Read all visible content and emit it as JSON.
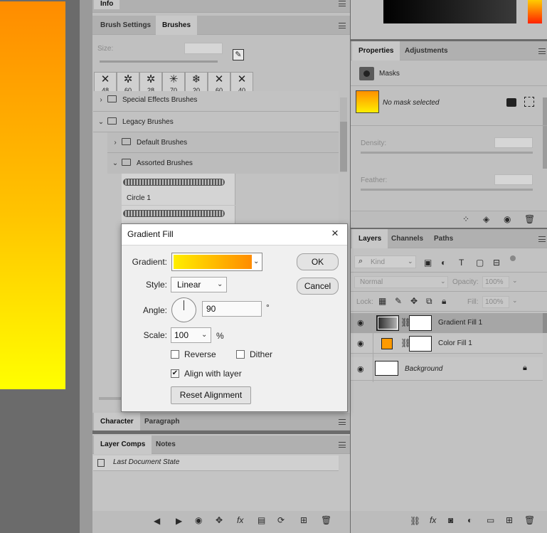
{
  "panels": {
    "info_tab": "Info",
    "brush_tabs": [
      "Brush Settings",
      "Brushes"
    ],
    "brushes": {
      "size_label": "Size:",
      "presets": [
        "48",
        "60",
        "28",
        "70",
        "20",
        "60",
        "40"
      ],
      "tree": {
        "special_effects": "Special Effects Brushes",
        "legacy": "Legacy Brushes",
        "default": "Default Brushes",
        "assorted": "Assorted Brushes",
        "circle": "Circle 1"
      }
    },
    "char_tabs": [
      "Character",
      "Paragraph"
    ],
    "comps_tabs": [
      "Layer Comps",
      "Notes"
    ],
    "comps_item": "Last Document State"
  },
  "properties": {
    "tabs": [
      "Properties",
      "Adjustments"
    ],
    "section": "Masks",
    "mask_status": "No mask selected",
    "density_label": "Density:",
    "feather_label": "Feather:"
  },
  "layers": {
    "tabs": [
      "Layers",
      "Channels",
      "Paths"
    ],
    "kind_placeholder": "Kind",
    "blend_mode": "Normal",
    "opacity_label": "Opacity:",
    "opacity_value": "100%",
    "lock_label": "Lock:",
    "fill_label": "Fill:",
    "fill_value": "100%",
    "items": [
      {
        "name": "Gradient Fill 1"
      },
      {
        "name": "Color Fill 1"
      },
      {
        "name": "Background"
      }
    ],
    "color_fill_swatch": "#ff9a00"
  },
  "dialog": {
    "title": "Gradient Fill",
    "gradient_label": "Gradient:",
    "style_label": "Style:",
    "style_value": "Linear",
    "angle_label": "Angle:",
    "angle_value": "90",
    "angle_unit": "°",
    "scale_label": "Scale:",
    "scale_value": "100",
    "scale_unit": "%",
    "reverse_label": "Reverse",
    "dither_label": "Dither",
    "align_label": "Align with layer",
    "reset_label": "Reset Alignment",
    "ok_label": "OK",
    "cancel_label": "Cancel",
    "gradient_from": "#ffee00",
    "gradient_to": "#ff8c00"
  }
}
